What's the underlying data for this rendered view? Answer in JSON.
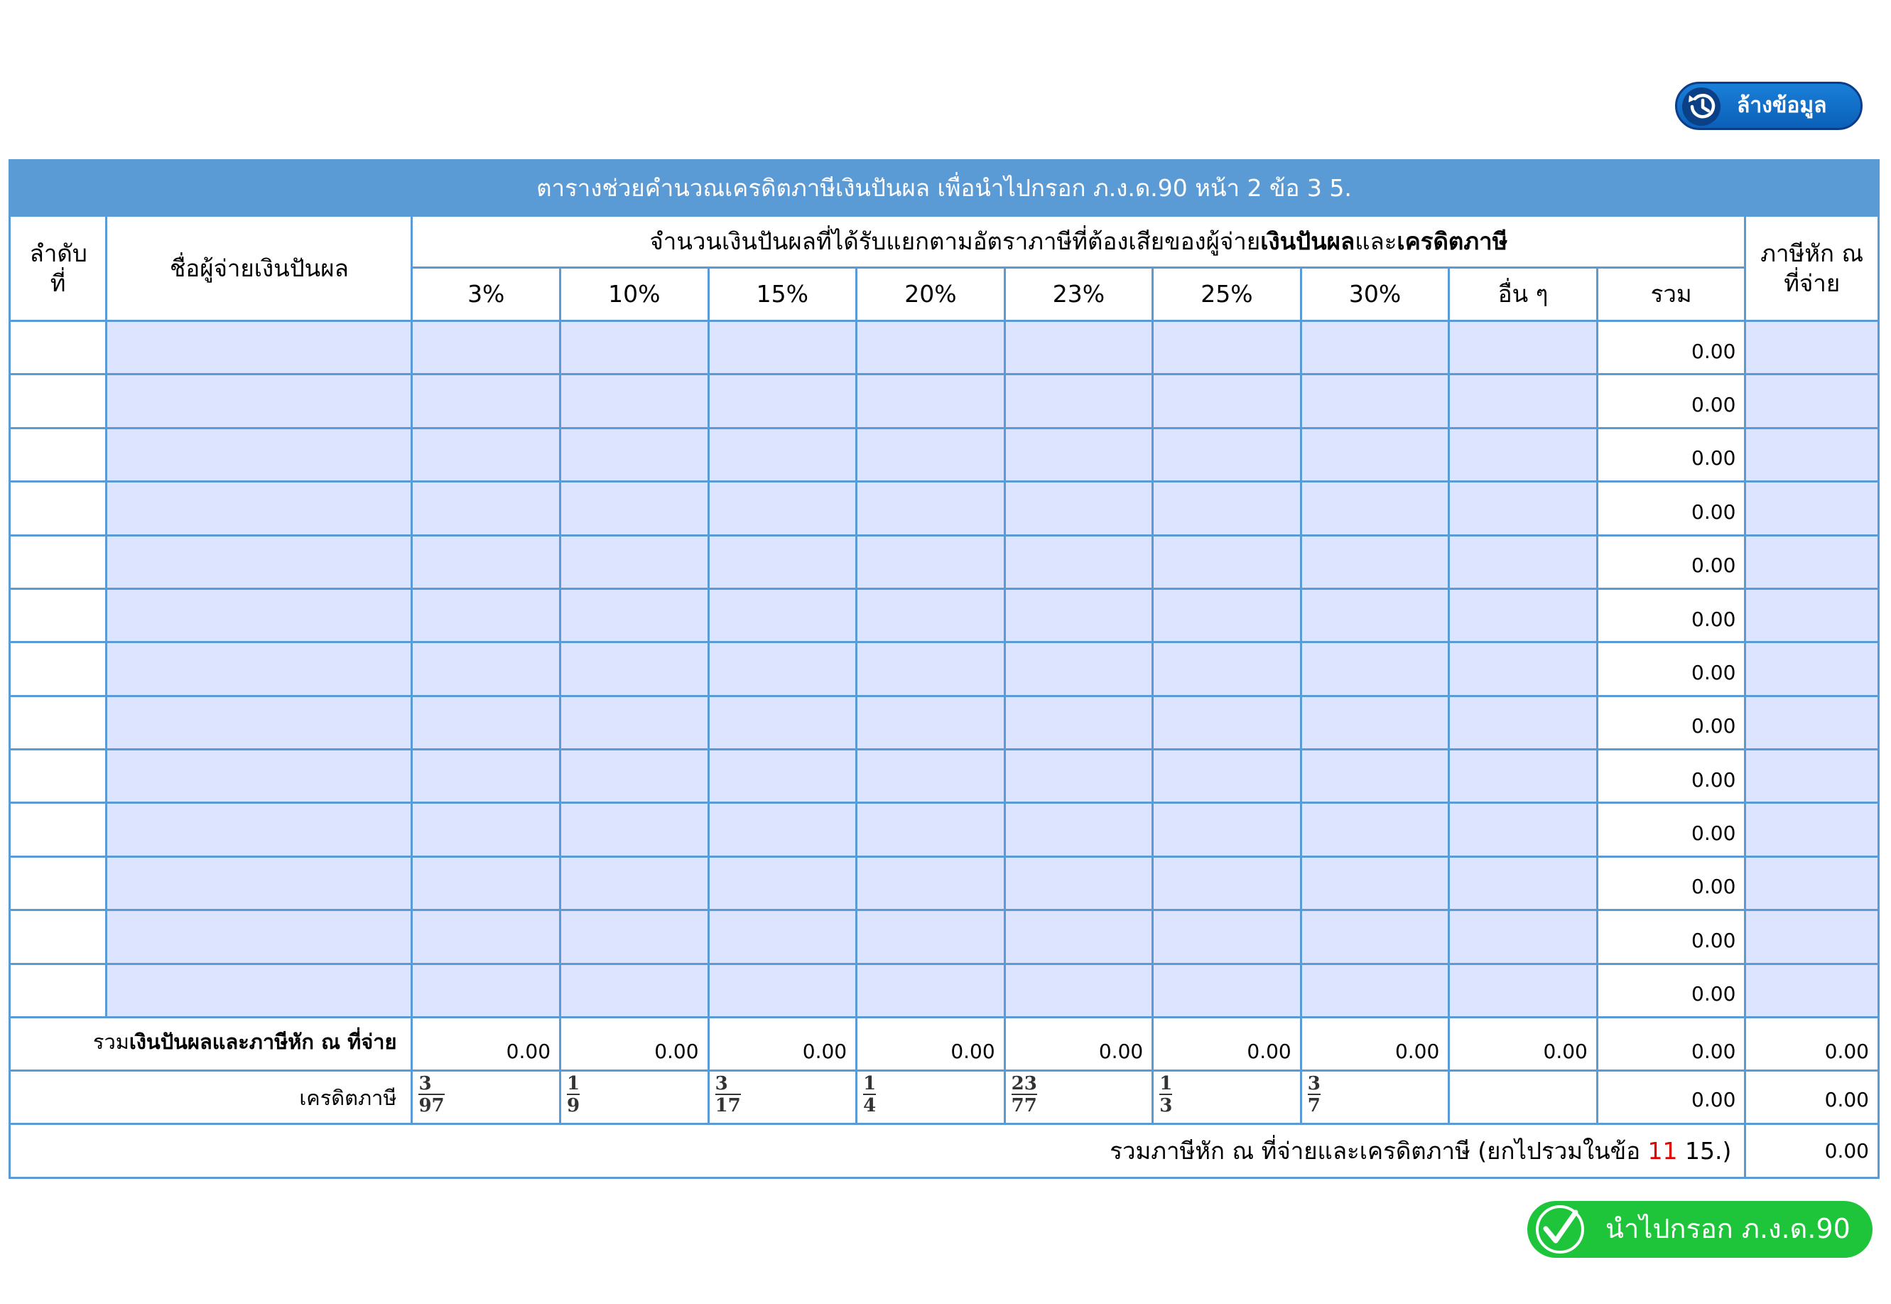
{
  "clear_button": {
    "label": "ล้างข้อมูล",
    "icon": "history-icon"
  },
  "table": {
    "title": "ตารางช่วยคำนวณเครดิตภาษีเงินปันผล เพื่อนำไปกรอก ภ.ง.ด.90 หน้า 2 ข้อ 3 5.",
    "col_order": "ลำดับ ที่",
    "col_payer": "ชื่อผู้จ่ายเงินปันผล",
    "group_header_prefix": "จำนวนเงินปันผลที่ได้รับแยกตามอัตราภาษีที่ต้องเสียของผู้จ่าย",
    "group_header_bold1": "เงินปันผล",
    "group_header_mid": "และ",
    "group_header_bold2": "เครดิตภาษี",
    "col_withholding": "ภาษีหัก ณ ที่จ่าย",
    "rates": [
      "3%",
      "10%",
      "15%",
      "20%",
      "23%",
      "25%",
      "30%",
      "อื่น ๆ",
      "รวม"
    ],
    "row_totals": [
      "0.00",
      "0.00",
      "0.00",
      "0.00",
      "0.00",
      "0.00",
      "0.00",
      "0.00",
      "0.00",
      "0.00",
      "0.00",
      "0.00",
      "0.00"
    ],
    "sum_label_prefix": "รวม",
    "sum_label_bold": "เงินปันผลและภาษีหัก ณ ที่จ่าย",
    "sum_values": [
      "0.00",
      "0.00",
      "0.00",
      "0.00",
      "0.00",
      "0.00",
      "0.00",
      "0.00",
      "0.00",
      "0.00"
    ],
    "credit_label": "เครดิตภาษี",
    "credit_fractions": [
      {
        "num": "3",
        "den": "97"
      },
      {
        "num": "1",
        "den": "9"
      },
      {
        "num": "3",
        "den": "17"
      },
      {
        "num": "1",
        "den": "4"
      },
      {
        "num": "23",
        "den": "77"
      },
      {
        "num": "1",
        "den": "3"
      },
      {
        "num": "3",
        "den": "7"
      }
    ],
    "credit_total": "0.00",
    "credit_withholding": "0.00",
    "grand_total_label_before": "รวมภาษีหัก ณ ที่จ่ายและเครดิตภาษี (ยกไปรวมในข้อ ",
    "grand_total_label_red": "11",
    "grand_total_label_after": " 15.)",
    "grand_total_value": "0.00"
  },
  "fill_button": {
    "label": "นำไปกรอก ภ.ง.ด.90",
    "icon": "checkmark-circle-icon"
  },
  "colors": {
    "header_blue": "#5b9bd5",
    "input_fill": "#dde4ff",
    "clear_button_blue": "#0b60b8",
    "fill_button_green": "#1ec43a",
    "highlight_red": "#e00000"
  }
}
